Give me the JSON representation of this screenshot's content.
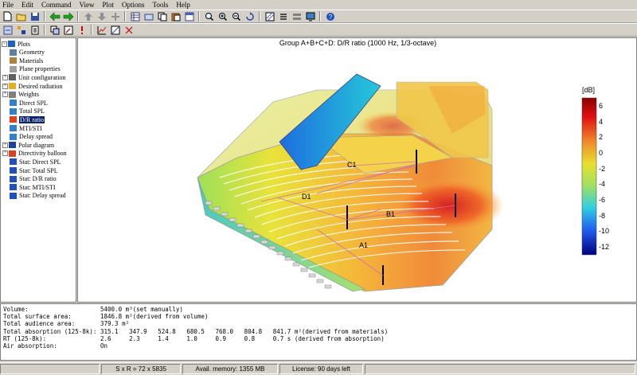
{
  "menu": [
    "File",
    "Edit",
    "Command",
    "View",
    "Plot",
    "Options",
    "Tools",
    "Help"
  ],
  "toolbar1": [
    "new-icon",
    "open-icon",
    "save-icon",
    "back-icon",
    "forward-icon",
    "up-icon",
    "down-icon",
    "add-icon",
    "table-icon",
    "grid-icon",
    "copy-icon",
    "paste-icon",
    "window-icon",
    "zoom-in-icon",
    "zoom-in-2-icon",
    "zoom-out-icon",
    "rotate-icon",
    "hatch-icon",
    "list-icon",
    "tile-icon",
    "screen-icon",
    "help-icon"
  ],
  "toolbar2": [
    "nav-icon",
    "tree-icon",
    "calc-icon",
    "stack-icon",
    "pen-icon",
    "warning-icon",
    "chart-icon",
    "grid-icon",
    "bug-icon"
  ],
  "tree": {
    "items": [
      {
        "label": "Plots",
        "expander": "-",
        "level": 0
      },
      {
        "label": "Geometry",
        "expander": "",
        "level": 1
      },
      {
        "label": "Materials",
        "expander": "",
        "level": 1
      },
      {
        "label": "Plane properties",
        "expander": "",
        "level": 1
      },
      {
        "label": "Unit configuration",
        "expander": "+",
        "level": 1
      },
      {
        "label": "Desired radiation",
        "expander": "+",
        "level": 1
      },
      {
        "label": "Weights",
        "expander": "+",
        "level": 1
      },
      {
        "label": "Direct SPL",
        "expander": "",
        "level": 1
      },
      {
        "label": "Total SPL",
        "expander": "",
        "level": 1
      },
      {
        "label": "D/R ratio",
        "expander": "",
        "level": 1,
        "selected": true
      },
      {
        "label": "MTI/STI",
        "expander": "",
        "level": 1
      },
      {
        "label": "Delay spread",
        "expander": "",
        "level": 1
      },
      {
        "label": "Polar diagram",
        "expander": "+",
        "level": 1
      },
      {
        "label": "Directivity balloon",
        "expander": "+",
        "level": 1
      },
      {
        "label": "Stat: Direct SPL",
        "expander": "",
        "level": 1
      },
      {
        "label": "Stat: Total SPL",
        "expander": "",
        "level": 1
      },
      {
        "label": "Stat: D/R ratio",
        "expander": "",
        "level": 1
      },
      {
        "label": "Stat: MTI/STI",
        "expander": "",
        "level": 1
      },
      {
        "label": "Stat: Delay spread",
        "expander": "",
        "level": 1
      }
    ]
  },
  "plot": {
    "title": "Group A+B+C+D: D/R ratio (1000 Hz, 1/3-octave)",
    "labels": [
      "C1",
      "D1",
      "B1",
      "A1"
    ],
    "colorbar": {
      "unit": "[dB]",
      "ticks": [
        "6",
        "4",
        "2",
        "0",
        "-2",
        "-4",
        "-6",
        "-8",
        "-10",
        "-12"
      ],
      "range": [
        -13,
        7
      ]
    }
  },
  "info": [
    {
      "key": "Volume:",
      "value": "5400.0 m³(set manually)"
    },
    {
      "key": "Total surface area:",
      "value": "1846.8 m²(derived from volume)"
    },
    {
      "key": "Total audience area:",
      "value": "379.3 m²"
    },
    {
      "key": "Total absorption (125-8k):",
      "value": "315.1   347.9   524.8   680.5   768.0   804.8   841.7 m²(derived from materials)"
    },
    {
      "key": "RT (125-8k):",
      "value": "2.6     2.3     1.4     1.0     0.9     0.8     0.7 s (derived from absorption)"
    },
    {
      "key": "Air absorption:",
      "value": "On"
    }
  ],
  "status": {
    "size": "S x R = 72 x 5835",
    "memory": "Avail. memory: 1355 MB",
    "license": "License: 90 days left"
  },
  "colors": {
    "selection": "#0a246a",
    "chrome": "#d4d0c8"
  }
}
